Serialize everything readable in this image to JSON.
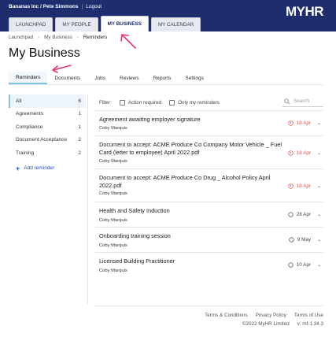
{
  "header": {
    "company": "Bananas Inc / Pete Simmons",
    "separator": "|",
    "logout": "Logout",
    "logo": "MYHR"
  },
  "nav_tabs": [
    {
      "label": "LAUNCHPAD"
    },
    {
      "label": "MY PEOPLE"
    },
    {
      "label": "MY BUSINESS"
    },
    {
      "label": "MY CALENDAR"
    }
  ],
  "breadcrumb": [
    "Launchpad",
    "My Business",
    "Reminders"
  ],
  "page_title": "My Business",
  "sub_tabs": [
    {
      "label": "Reminders"
    },
    {
      "label": "Documents"
    },
    {
      "label": "Jobs"
    },
    {
      "label": "Reviews"
    },
    {
      "label": "Reports"
    },
    {
      "label": "Settings"
    }
  ],
  "sidebar": {
    "items": [
      {
        "label": "All",
        "count": "6"
      },
      {
        "label": "Agreements",
        "count": "1"
      },
      {
        "label": "Compliance",
        "count": "1"
      },
      {
        "label": "Document Acceptance",
        "count": "2"
      },
      {
        "label": "Training",
        "count": "2"
      }
    ],
    "add_label": "Add reminder"
  },
  "filters": {
    "label": "Filter:",
    "action_required": "Action required",
    "only_mine": "Only my reminders",
    "search_placeholder": "Search"
  },
  "reminders": [
    {
      "title": "Agreement awaiting employer signature",
      "person": "Coby Marquis",
      "date": "18 Apr",
      "overdue": true
    },
    {
      "title": "Document to accept: ACME Produce Co Company Motor Vehicle _ Fuel Card (letter to employee) April 2022.pdf",
      "person": "Coby Marquis",
      "date": "18 Apr",
      "overdue": true
    },
    {
      "title": "Document to accept: ACME Produce Co Drug _ Alcohol Policy April 2022.pdf",
      "person": "Coby Marquis",
      "date": "18 Apr",
      "overdue": true
    },
    {
      "title": "Health and Safety Induction",
      "person": "Coby Marquis",
      "date": "28 Apr",
      "overdue": false
    },
    {
      "title": "Onboarding training session",
      "person": "Coby Marquis",
      "date": "9 May",
      "overdue": false
    },
    {
      "title": "Licensed Building Practitioner",
      "person": "Coby Marquis",
      "date": "10 Apr",
      "overdue": false
    }
  ],
  "footer": {
    "terms": "Terms & Conditions",
    "privacy": "Privacy Policy",
    "terms_of_use": "Terms of Use",
    "copyright": "©2022 MyHR Limited",
    "version": "v: mf-1.34.3"
  },
  "colors": {
    "header_bg": "#1d2d6e",
    "accent": "#7dc4e6",
    "overdue": "#d9534f",
    "annotation_arrow": "#e8356d"
  }
}
